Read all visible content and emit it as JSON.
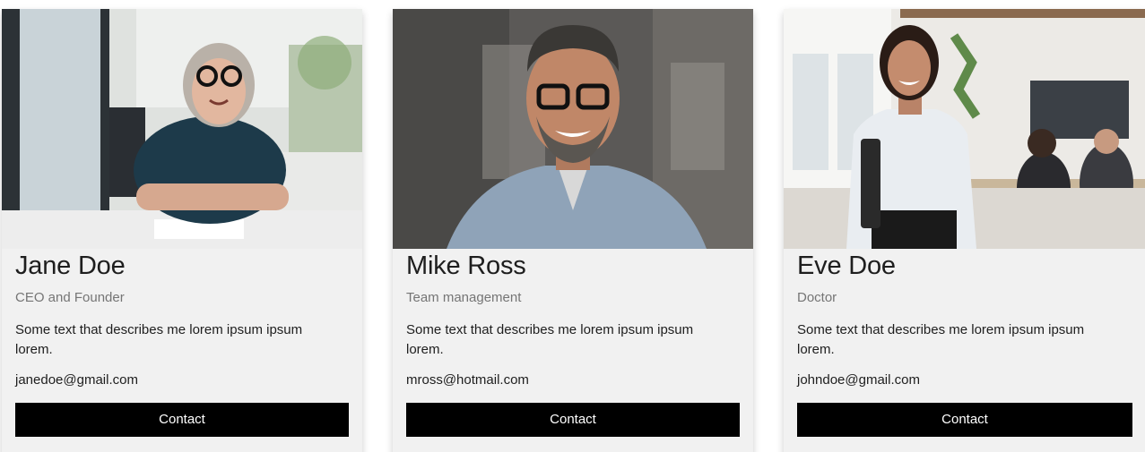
{
  "cards": [
    {
      "name": "Jane Doe",
      "title": "CEO and Founder",
      "description": "Some text that describes me lorem ipsum ipsum lorem.",
      "email": "janedoe@gmail.com",
      "button_label": "Contact"
    },
    {
      "name": "Mike Ross",
      "title": "Team management",
      "description": "Some text that describes me lorem ipsum ipsum lorem.",
      "email": "mross@hotmail.com",
      "button_label": "Contact"
    },
    {
      "name": "Eve Doe",
      "title": "Doctor",
      "description": "Some text that describes me lorem ipsum ipsum lorem.",
      "email": "johndoe@gmail.com",
      "button_label": "Contact"
    }
  ],
  "colors": {
    "card_background": "#f1f1f1",
    "button_background": "#000000",
    "button_text": "#ffffff",
    "title_text": "#757575"
  }
}
